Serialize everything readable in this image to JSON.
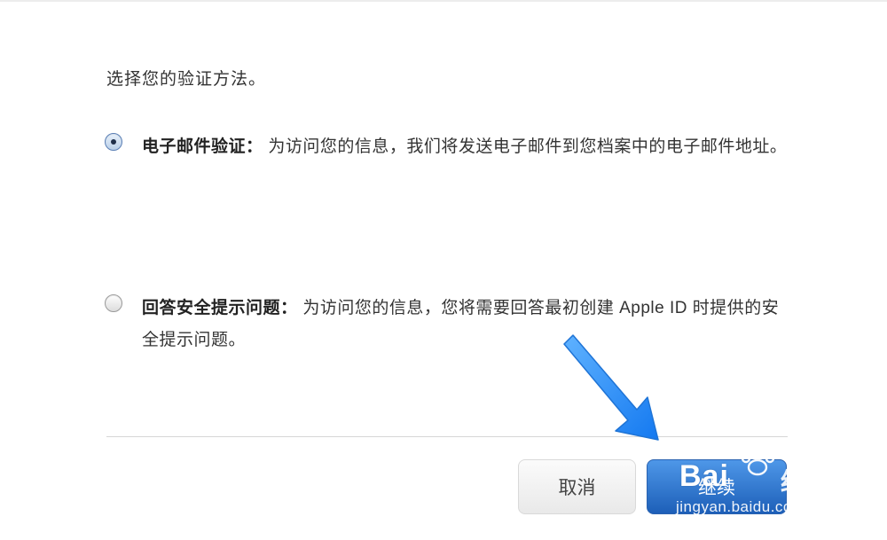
{
  "prompt": "选择您的验证方法。",
  "options": [
    {
      "title": "电子邮件验证",
      "separator": "：",
      "description": "为访问您的信息，我们将发送电子邮件到您档案中的电子邮件地址。",
      "selected": true
    },
    {
      "title": "回答安全提示问题",
      "separator": "：",
      "description": "为访问您的信息，您将需要回答最初创建 Apple ID 时提供的安全提示问题。",
      "selected": false
    }
  ],
  "buttons": {
    "cancel_label": "取消",
    "continue_label": "继续"
  },
  "watermark": {
    "brand": "Bai",
    "brand_suffix": "经验",
    "url": "jingyan.baidu.com"
  },
  "colors": {
    "primary_button": "#1d5fb8",
    "arrow": "#2f90ff"
  }
}
